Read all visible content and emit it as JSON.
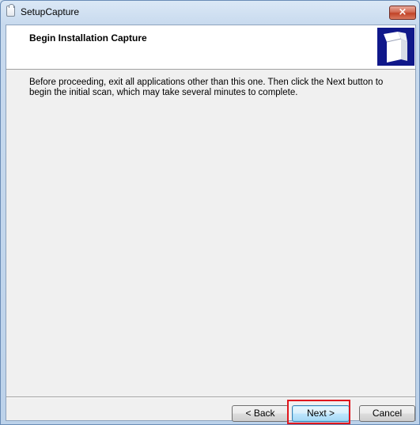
{
  "window": {
    "title": "SetupCapture",
    "close_label": "×"
  },
  "header": {
    "title": "Begin Installation Capture"
  },
  "body": {
    "text": "Before proceeding, exit all applications other than this one. Then click the Next button to begin the initial scan, which may take several minutes to complete."
  },
  "buttons": {
    "back": "< Back",
    "next": "Next >",
    "cancel": "Cancel"
  },
  "colors": {
    "highlight": "#e0161d",
    "header_graphic": "#10188a"
  },
  "icons": {
    "app": "app-document-icon",
    "header": "box-installer-icon"
  }
}
